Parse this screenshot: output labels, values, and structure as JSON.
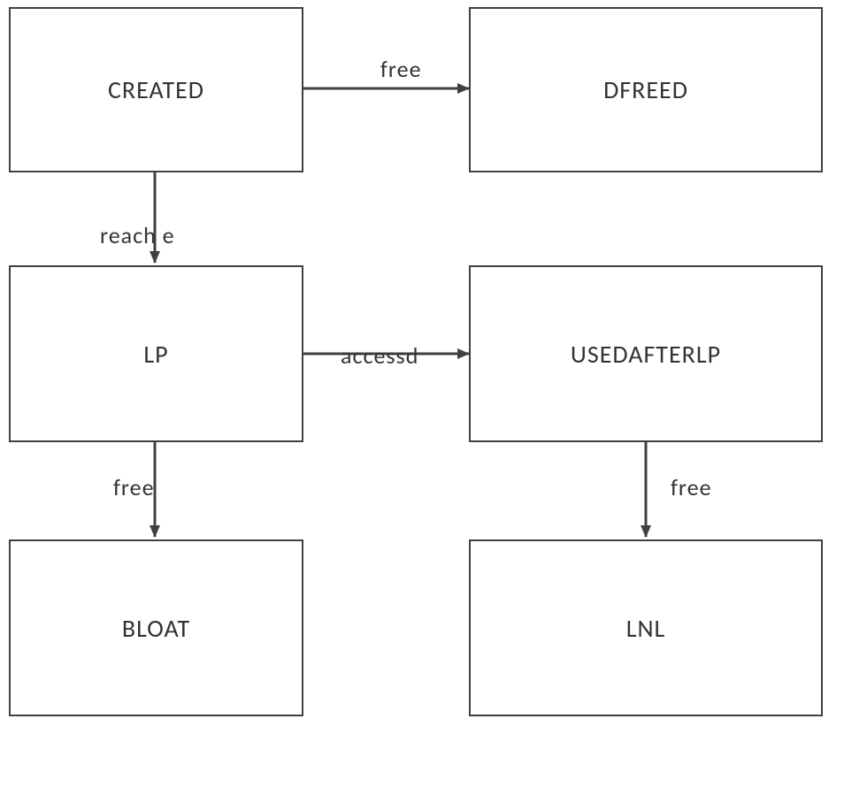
{
  "nodes": {
    "created": {
      "label": "CREATED"
    },
    "dfreed": {
      "label": "DFREED"
    },
    "lp": {
      "label": "LP"
    },
    "usedafterlp": {
      "label": "USEDAFTERLP"
    },
    "bloat": {
      "label": "BLOAT"
    },
    "lnl": {
      "label": "LNL"
    }
  },
  "edges": {
    "created_to_dfreed": {
      "label": "free"
    },
    "created_to_lp": {
      "label": "reach e"
    },
    "lp_to_usedafterlp": {
      "label": "accessd"
    },
    "lp_to_bloat": {
      "label": "free"
    },
    "usedafterlp_to_lnl": {
      "label": "free"
    }
  },
  "chart_data": {
    "type": "state-diagram",
    "states": [
      "CREATED",
      "DFREED",
      "LP",
      "USEDAFTERLP",
      "BLOAT",
      "LNL"
    ],
    "transitions": [
      {
        "from": "CREATED",
        "to": "DFREED",
        "label": "free"
      },
      {
        "from": "CREATED",
        "to": "LP",
        "label": "reach e"
      },
      {
        "from": "LP",
        "to": "USEDAFTERLP",
        "label": "accessd"
      },
      {
        "from": "LP",
        "to": "BLOAT",
        "label": "free"
      },
      {
        "from": "USEDAFTERLP",
        "to": "LNL",
        "label": "free"
      }
    ]
  }
}
